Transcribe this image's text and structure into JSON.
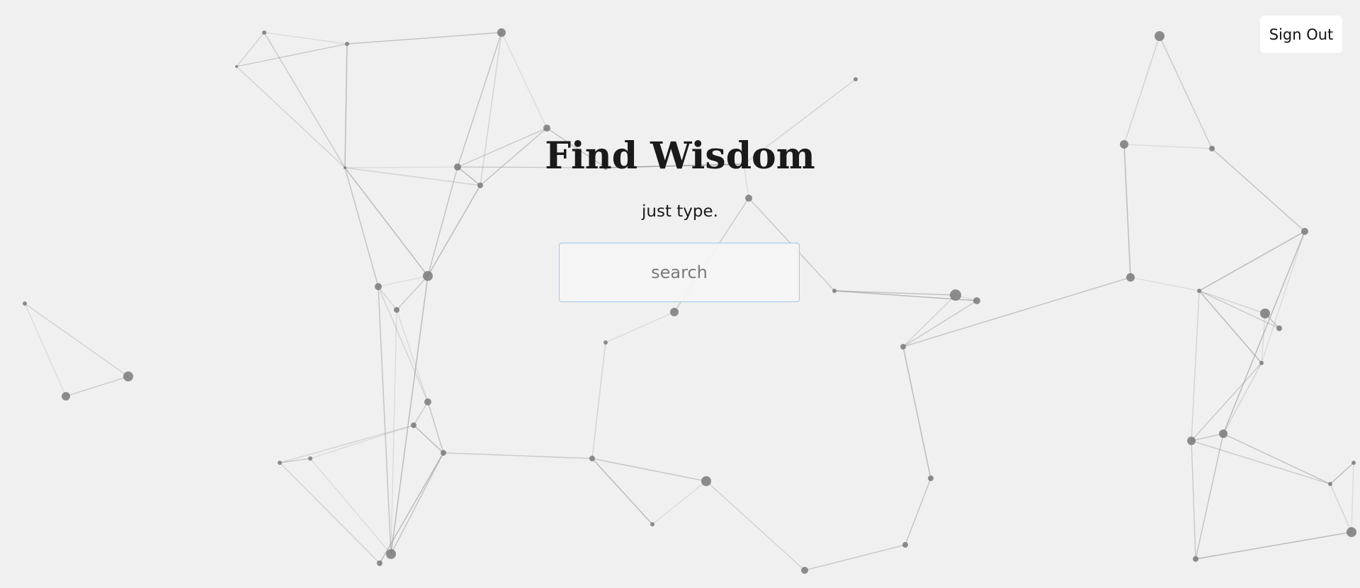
{
  "header": {
    "sign_out_label": "Sign Out"
  },
  "hero": {
    "title": "Find Wisdom",
    "subtitle": "just type."
  },
  "search": {
    "placeholder": "search",
    "value": ""
  },
  "colors": {
    "background": "#f0f0f0",
    "node": "#7a7a7a",
    "edge": "#9a9a9a",
    "search_border": "#9ec6ef"
  }
}
